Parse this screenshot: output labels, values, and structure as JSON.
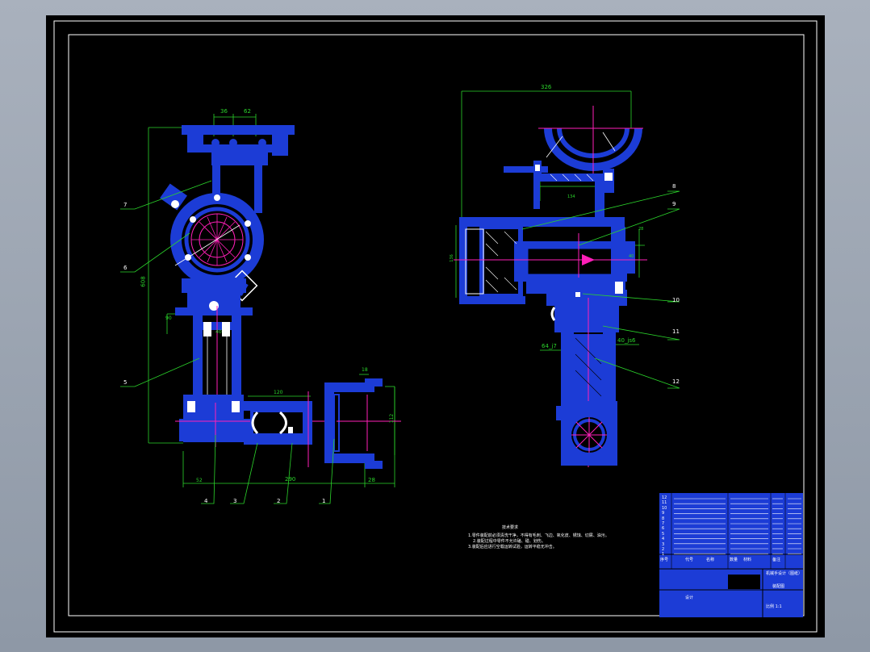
{
  "colors": {
    "part": "#1c3cd6",
    "center_line": "#ff1fb8",
    "dimension": "#2bd52b",
    "leader": "#2bd52b",
    "hatch": "#ffffff",
    "border": "#ffffff",
    "sheet": "#000000"
  },
  "left_view": {
    "dims": {
      "top_a": "36",
      "top_b": "62",
      "height": "608",
      "bottom_total": "290",
      "bottom_a": "52",
      "bottom_b": "28",
      "mid_a": "90",
      "mid_b": "40",
      "gripper_w": "18",
      "gripper_h": "112",
      "arm_w": "120"
    },
    "callouts": [
      "7",
      "6",
      "5",
      "4",
      "3",
      "2",
      "1"
    ]
  },
  "right_view": {
    "dims": {
      "top_width": "326",
      "inner": "134",
      "left_h": "136",
      "shaft_a": "64_j7",
      "shaft_b": "40_js6",
      "box_a": "28",
      "box_b": "40"
    },
    "callouts": [
      "8",
      "9",
      "10",
      "11",
      "12"
    ]
  },
  "notes": {
    "heading": "技术要求",
    "line1": "1.零件装配前必须清洗干净，不得有毛刺、飞边、氧化皮、锈蚀、切屑、油污。",
    "line2": "2.装配过程中零件不允许磕、碰、划伤。",
    "line3": "3.装配后应进行空载运转试验，运转平稳无冲击。"
  },
  "title_block": {
    "row_numbers": [
      "12",
      "11",
      "10",
      "9",
      "8",
      "7",
      "6",
      "5",
      "4",
      "3",
      "2",
      "1"
    ],
    "header_seq": "序号",
    "header_code": "代号",
    "header_name": "名称",
    "header_qty": "数量",
    "header_material": "材料",
    "header_remark": "备注",
    "project_title": "机械手设计（图纸）",
    "project_sub": "装配图",
    "drawn_label": "设计",
    "scale_label": "比例 1:1"
  }
}
